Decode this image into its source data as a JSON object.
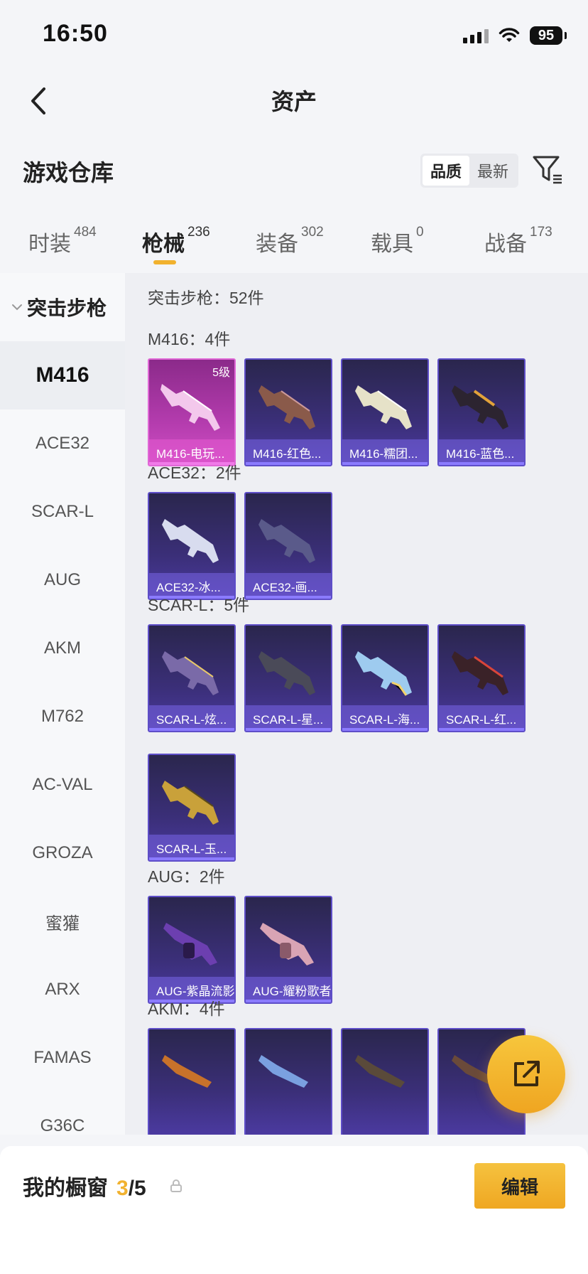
{
  "status_bar": {
    "time": "16:50",
    "battery": "95"
  },
  "nav": {
    "title": "资产"
  },
  "section": {
    "title": "游戏仓库",
    "sort_options": [
      "品质",
      "最新"
    ]
  },
  "tabs": [
    {
      "label": "时装",
      "count": "484"
    },
    {
      "label": "枪械",
      "count": "236"
    },
    {
      "label": "装备",
      "count": "302"
    },
    {
      "label": "载具",
      "count": "0"
    },
    {
      "label": "战备",
      "count": "173"
    }
  ],
  "sidebar": {
    "group": "突击步枪",
    "items": [
      "M416",
      "ACE32",
      "SCAR-L",
      "AUG",
      "AKM",
      "M762",
      "AC-VAL",
      "GROZA",
      "蜜獾",
      "ARX",
      "FAMAS",
      "G36C"
    ]
  },
  "content": {
    "summary": "突击步枪：52件",
    "groups": [
      {
        "title": "M416：4件",
        "cards": [
          {
            "name": "M416-电玩...",
            "level": "5级",
            "rarity": "pink"
          },
          {
            "name": "M416-红色..."
          },
          {
            "name": "M416-糯团..."
          },
          {
            "name": "M416-蓝色..."
          }
        ]
      },
      {
        "title": "ACE32：2件",
        "cards": [
          {
            "name": "ACE32-冰..."
          },
          {
            "name": "ACE32-画..."
          }
        ]
      },
      {
        "title": "SCAR-L：5件",
        "cards": [
          {
            "name": "SCAR-L-炫..."
          },
          {
            "name": "SCAR-L-星..."
          },
          {
            "name": "SCAR-L-海..."
          },
          {
            "name": "SCAR-L-红..."
          },
          {
            "name": "SCAR-L-玉..."
          }
        ]
      },
      {
        "title": "AUG：2件",
        "cards": [
          {
            "name": "AUG-紫晶流影"
          },
          {
            "name": "AUG-耀粉歌者"
          }
        ]
      },
      {
        "title": "AKM：4件",
        "cards": [
          {
            "name": ""
          },
          {
            "name": ""
          },
          {
            "name": ""
          },
          {
            "name": ""
          }
        ]
      }
    ]
  },
  "bottom": {
    "title": "我的橱窗",
    "current": "3",
    "total": "/5",
    "edit_label": "编辑"
  },
  "colors": {
    "accent": "#f1b22f",
    "card_purple": "#3b2f79",
    "card_pink": "#b43cae"
  },
  "icons": [
    "back-icon",
    "wifi-icon",
    "signal-icon",
    "filter-icon",
    "chevron-down-icon",
    "share-icon",
    "lock-icon"
  ]
}
